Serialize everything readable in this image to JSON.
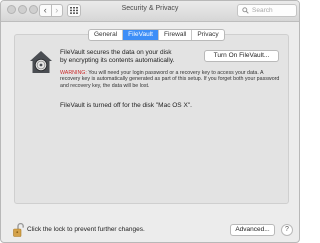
{
  "window": {
    "title": "Security & Privacy"
  },
  "toolbar": {
    "back_glyph": "‹",
    "forward_glyph": "›",
    "search_placeholder": "Search"
  },
  "tabs": [
    {
      "label": "General",
      "active": false
    },
    {
      "label": "FileVault",
      "active": true
    },
    {
      "label": "Firewall",
      "active": false
    },
    {
      "label": "Privacy",
      "active": false
    }
  ],
  "filevault": {
    "intro": "FileVault secures the data on your disk by encrypting its contents automatically.",
    "turn_on_label": "Turn On FileVault...",
    "warning_label": "WARNING:",
    "warning_text": " You will need your login password or a recovery key to access your data. A recovery key is automatically generated as part of this setup. If you forget both your password and recovery key, the data will be lost.",
    "status": "FileVault is turned off for the disk \"Mac OS X\"."
  },
  "footer": {
    "lock_text": "Click the lock to prevent further changes.",
    "advanced_label": "Advanced...",
    "help_label": "?"
  },
  "colors": {
    "accent": "#3d8ef7",
    "warning": "#cc2a2a",
    "lock": "#d4a24a"
  },
  "icons": {
    "filevault": "filevault-house-icon",
    "lock": "padlock-open-icon",
    "search": "magnifier-icon",
    "grid": "grid-icon"
  }
}
